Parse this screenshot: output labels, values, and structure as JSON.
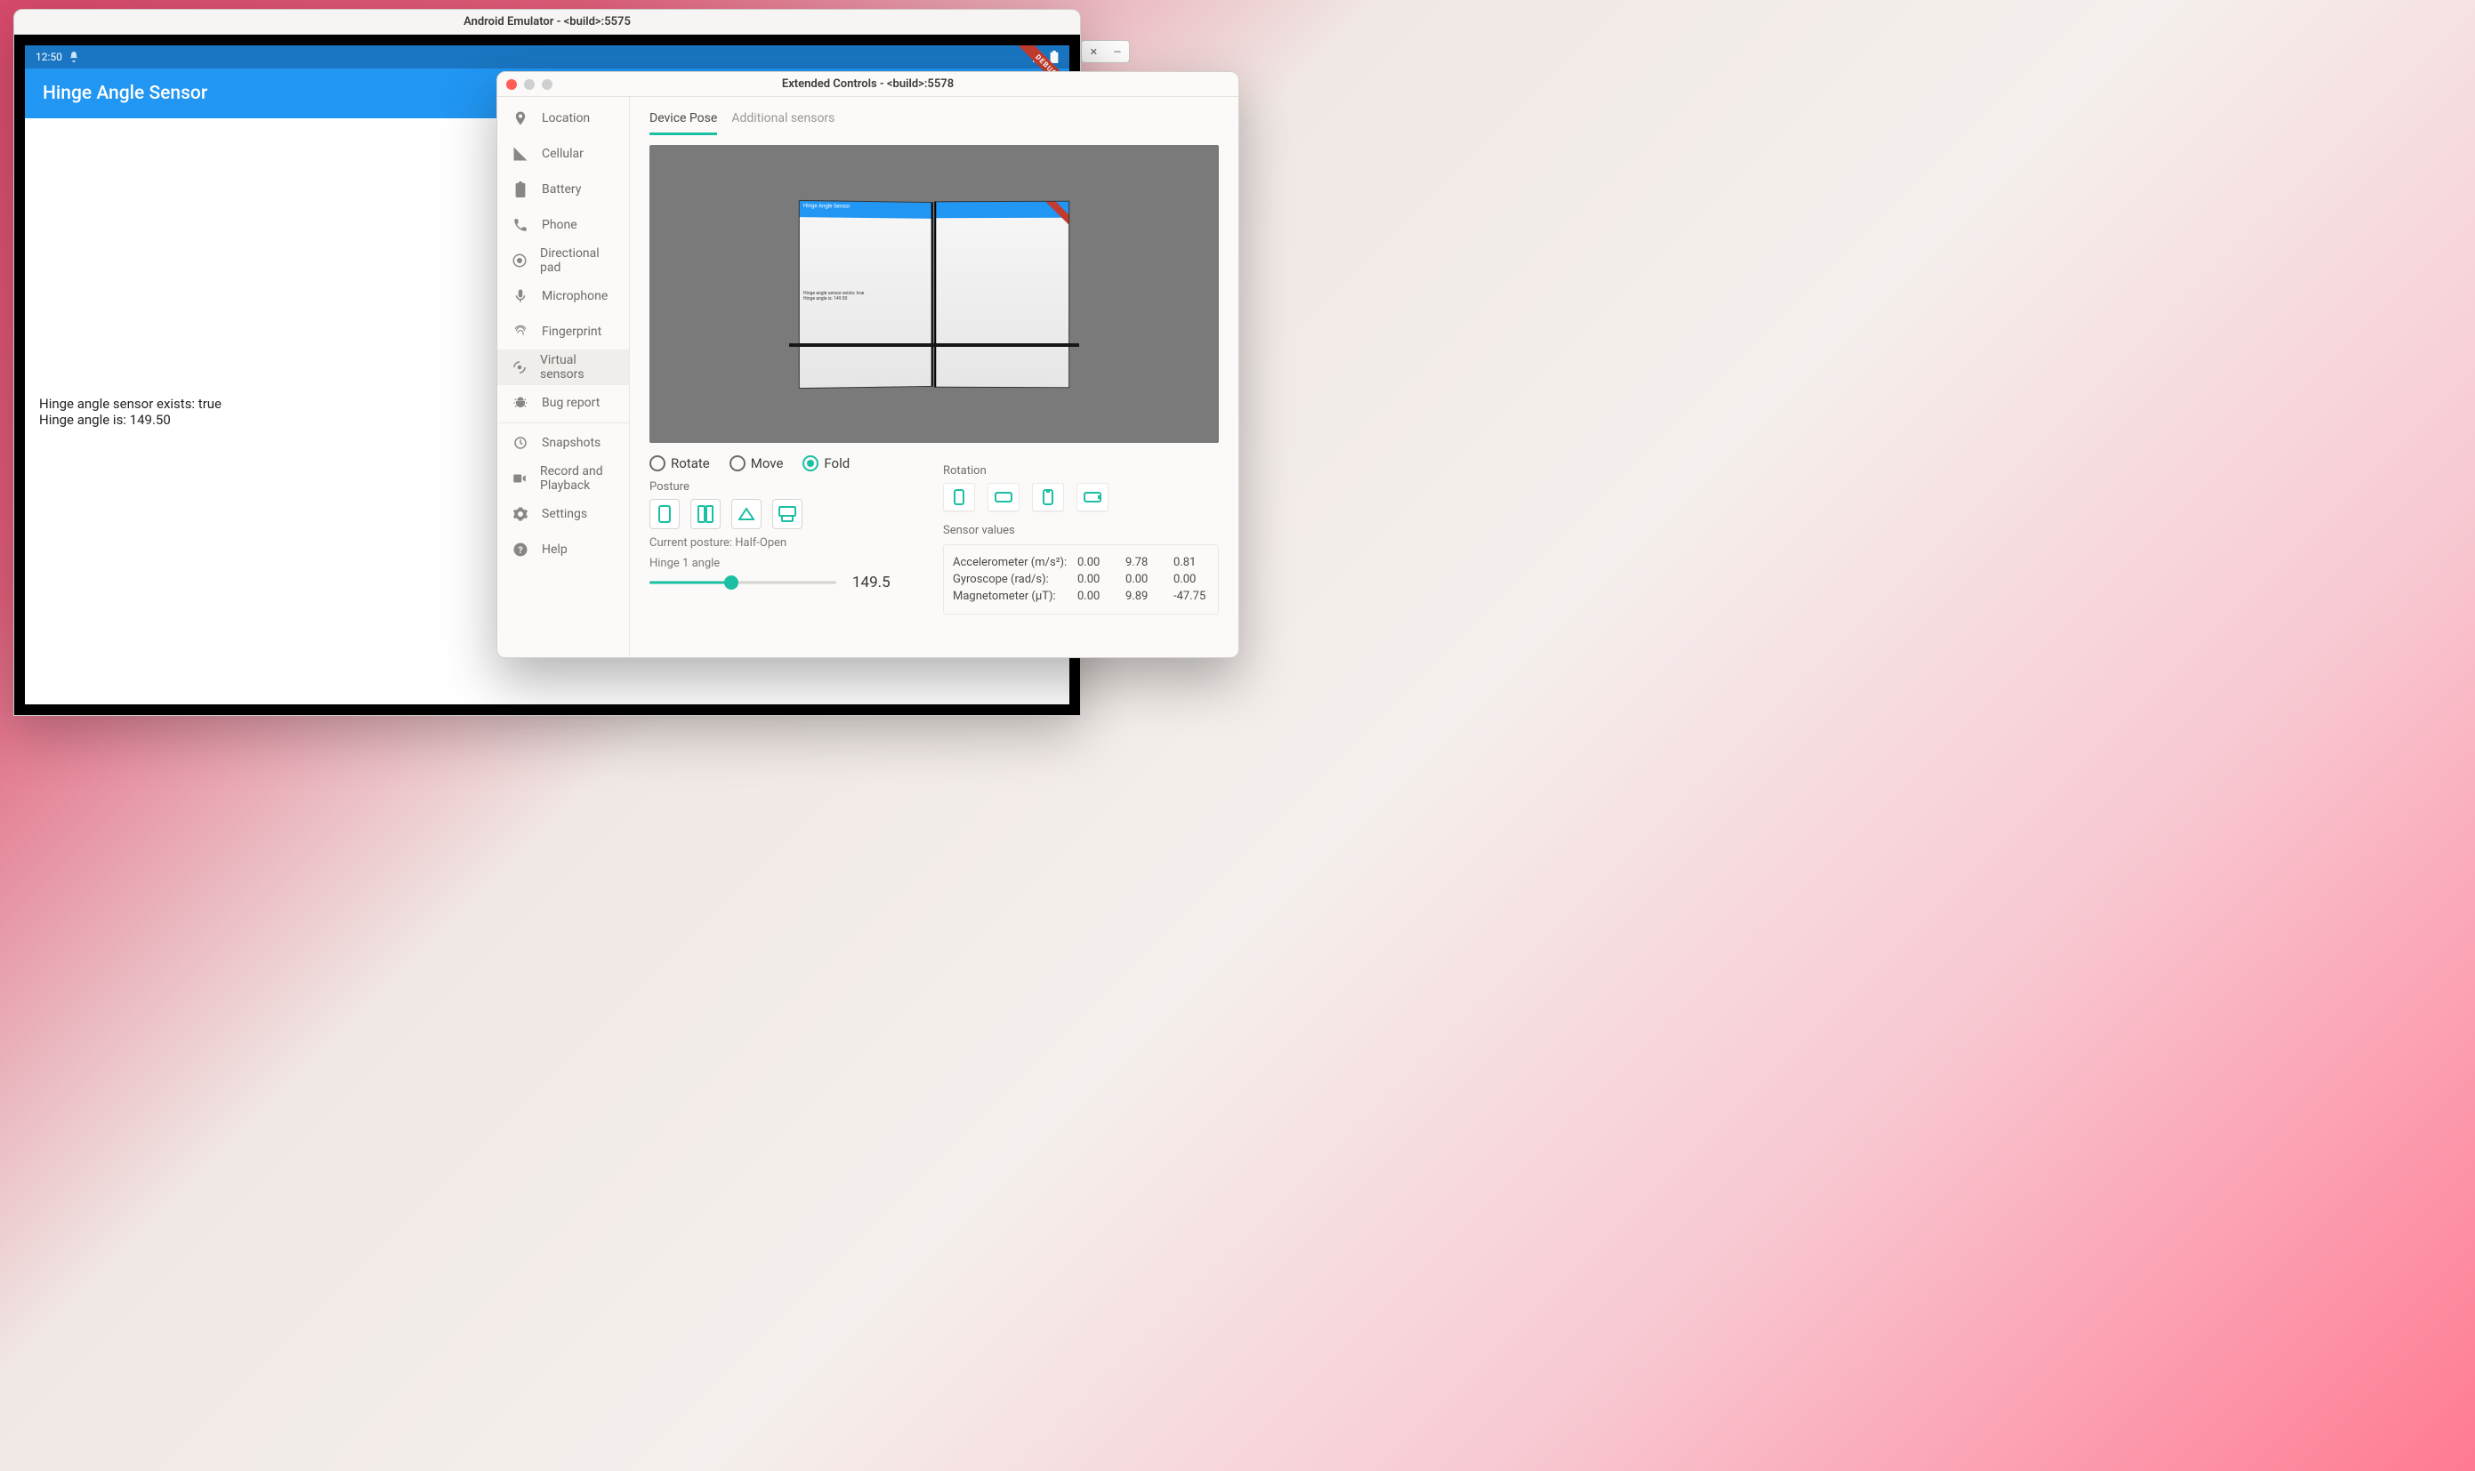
{
  "emulator": {
    "title": "Android Emulator - <build>:5575",
    "status_time": "12:50",
    "app_title": "Hinge Angle Sensor",
    "body_line1": "Hinge angle sensor exists: true",
    "body_line2": "Hinge angle is: 149.50"
  },
  "controls": {
    "title": "Extended Controls - <build>:5578",
    "sidebar": {
      "items": [
        {
          "label": "Location"
        },
        {
          "label": "Cellular"
        },
        {
          "label": "Battery"
        },
        {
          "label": "Phone"
        },
        {
          "label": "Directional pad"
        },
        {
          "label": "Microphone"
        },
        {
          "label": "Fingerprint"
        },
        {
          "label": "Virtual sensors"
        },
        {
          "label": "Bug report"
        },
        {
          "label": "Snapshots"
        },
        {
          "label": "Record and Playback"
        },
        {
          "label": "Settings"
        },
        {
          "label": "Help"
        }
      ]
    },
    "tabs": {
      "pose": "Device Pose",
      "additional": "Additional sensors"
    },
    "modes": {
      "rotate": "Rotate",
      "move": "Move",
      "fold": "Fold"
    },
    "posture_label": "Posture",
    "current_posture": "Current posture: Half-Open",
    "hinge_label": "Hinge 1 angle",
    "hinge_value": "149.5",
    "rotation_label": "Rotation",
    "sensor_values_label": "Sensor values",
    "sensors": {
      "accel": {
        "label": "Accelerometer (m/s²):",
        "x": "0.00",
        "y": "9.78",
        "z": "0.81"
      },
      "gyro": {
        "label": "Gyroscope (rad/s):",
        "x": "0.00",
        "y": "0.00",
        "z": "0.00"
      },
      "mag": {
        "label": "Magnetometer (µT):",
        "x": "0.00",
        "y": "9.89",
        "z": "-47.75"
      }
    }
  },
  "preview_text": {
    "title": "Hinge Angle Sensor",
    "l1": "Hinge angle sensor exists: true",
    "l2": "Hinge angle is: 149.50"
  }
}
